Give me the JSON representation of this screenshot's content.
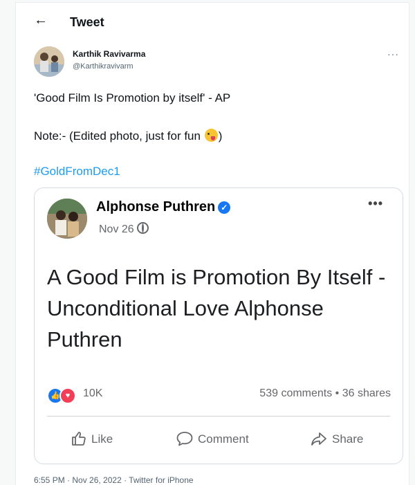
{
  "header": {
    "back_icon": "back-arrow-icon",
    "title": "Tweet"
  },
  "tweet": {
    "author_name": "Karthik Ravivarma",
    "author_handle": "@Karthikravivarm",
    "more": "···",
    "line1": "'Good Film Is Promotion by itself' - AP",
    "line2_before": "Note:- (Edited photo, just for fun ",
    "line2_after": ")",
    "hashtag": "#GoldFromDec1",
    "meta": "6:55 PM · Nov 26, 2022 · Twitter for iPhone",
    "link_color": "#1d9bf0"
  },
  "embed": {
    "name": "Alphonse Puthren",
    "verified_icon": "verified-check-icon",
    "date": "Nov 26",
    "privacy_icon": "globe-icon",
    "more": "•••",
    "text": "A Good Film is Promotion By Itself - Unconditional Love Alphonse Puthren",
    "reaction_count": "10K",
    "stats": "539 comments • 36 shares",
    "actions": {
      "like": "Like",
      "comment": "Comment",
      "share": "Share"
    },
    "brand_color": "#1877f2"
  }
}
